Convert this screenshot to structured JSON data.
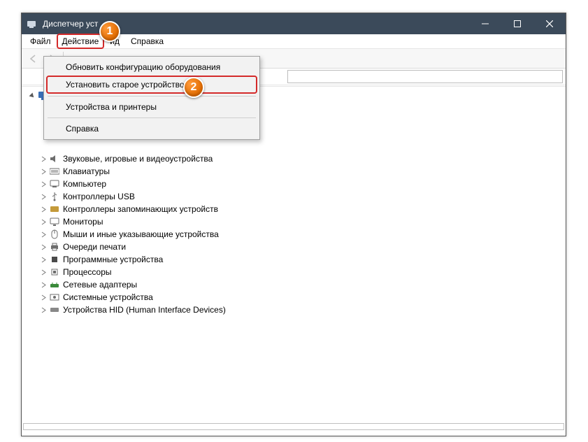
{
  "window": {
    "title": "Диспетчер уст"
  },
  "menubar": {
    "file": "Файл",
    "action": "Действие",
    "view": "ид",
    "help": "Справка"
  },
  "dropdown": {
    "refresh": "Обновить конфигурацию оборудования",
    "legacy": "Установить старое устройство",
    "devices": "Устройства и принтеры",
    "help": "Справка"
  },
  "tree": {
    "root": "",
    "nodes": [
      "Звуковые, игровые и видеоустройства",
      "Клавиатуры",
      "Компьютер",
      "Контроллеры USB",
      "Контроллеры запоминающих устройств",
      "Мониторы",
      "Мыши и иные указывающие устройства",
      "Очереди печати",
      "Программные устройства",
      "Процессоры",
      "Сетевые адаптеры",
      "Системные устройства",
      "Устройства HID (Human Interface Devices)"
    ]
  },
  "badges": {
    "one": "1",
    "two": "2"
  },
  "icons": {
    "hidden": [
      "",
      "",
      "",
      ""
    ]
  }
}
